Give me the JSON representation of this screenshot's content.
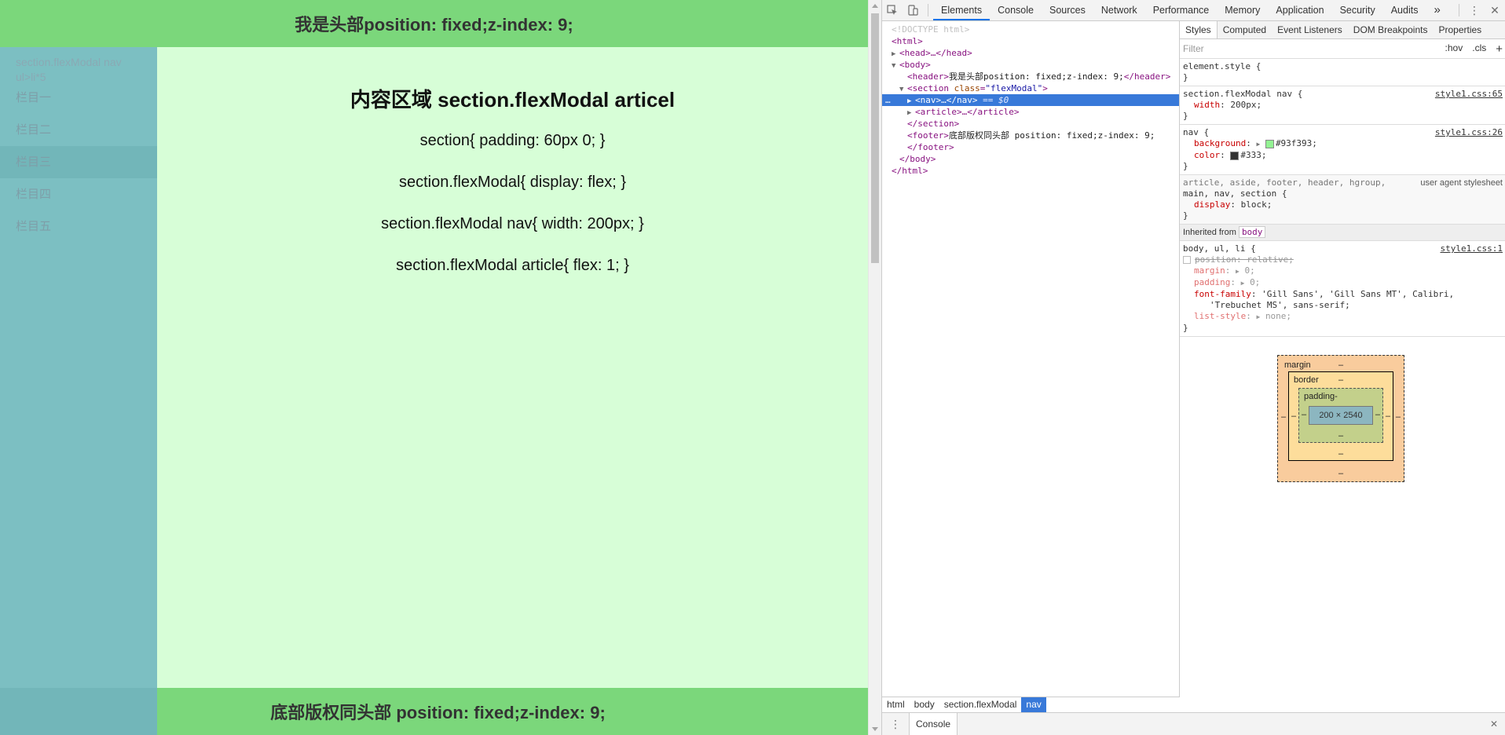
{
  "page": {
    "header_text": "我是头部position: fixed;z-index: 9;",
    "nav": {
      "title": "section.flexModal nav ul>li*5",
      "items": [
        "栏目一",
        "栏目二",
        "栏目三",
        "栏目四",
        "栏目五"
      ],
      "active_index": 2
    },
    "article": {
      "heading": "内容区域 section.flexModal articel",
      "lines": [
        "section{ padding: 60px 0; }",
        "section.flexModal{ display: flex; }",
        "section.flexModal nav{ width: 200px; }",
        "section.flexModal article{ flex: 1; }"
      ]
    },
    "footer_text": "底部版权同头部 position: fixed;z-index: 9;"
  },
  "devtools": {
    "tabs": [
      "Elements",
      "Console",
      "Sources",
      "Network",
      "Performance",
      "Memory",
      "Application",
      "Security",
      "Audits"
    ],
    "active_tab": "Elements",
    "more_tabs": "»",
    "elements_tree": {
      "doctype": "<!DOCTYPE html>",
      "html_open": "<html>",
      "head": "<head>…</head>",
      "body_open": "<body>",
      "header_open": "<header>",
      "header_text": "我是头部position: fixed;z-index: 9;",
      "header_close": "</header>",
      "section_tag": "<section",
      "section_attr": "class",
      "section_val": "\"flexModal\"",
      "section_end": ">",
      "nav": "<nav>…</nav>",
      "selected_marker": "== $0",
      "gutter_dots": "…",
      "article": "<article>…</article>",
      "section_close": "</section>",
      "footer_open": "<footer>",
      "footer_text": "底部版权同头部 position: fixed;z-index: 9;",
      "footer_close": "</footer>",
      "body_close": "</body>",
      "html_close": "</html>"
    },
    "breadcrumb": [
      "html",
      "body",
      "section.flexModal",
      "nav"
    ],
    "styles_tabs": [
      "Styles",
      "Computed",
      "Event Listeners",
      "DOM Breakpoints",
      "Properties"
    ],
    "filter_placeholder": "Filter",
    "filter_hov": ":hov",
    "filter_cls": ".cls",
    "filter_add": "+",
    "rules": {
      "element_style": "element.style {",
      "r1_selector": "section.flexModal nav {",
      "r1_source": "style1.css:65",
      "r1_prop": "width",
      "r1_value": "200px;",
      "r2_selector": "nav {",
      "r2_source": "style1.css:26",
      "r2_bg_prop": "background",
      "r2_bg_value": "#93f393;",
      "r2_bg_color": "#93f393",
      "r2_color_prop": "color",
      "r2_color_value": "#333;",
      "r2_color_color": "#333333",
      "ua_selector_1": "article, aside, footer, header, hgroup,",
      "ua_selector_2": "main, nav, section {",
      "ua_source": "user agent stylesheet",
      "ua_prop": "display",
      "ua_value": "block;",
      "inherited_label": "Inherited from",
      "inherited_from": "body",
      "r3_selector": "body, ul, li {",
      "r3_source": "style1.css:1",
      "r3_position": "position: relative;",
      "r3_margin_prop": "margin",
      "r3_margin_value": "0;",
      "r3_padding_prop": "padding",
      "r3_padding_value": "0;",
      "r3_font_prop": "font-family",
      "r3_font_value_1": "'Gill Sans', 'Gill Sans MT', Calibri,",
      "r3_font_value_2": "'Trebuchet MS', sans-serif;",
      "r3_list_prop": "list-style",
      "r3_list_value": "none;",
      "close_brace": "}"
    },
    "box_model": {
      "margin_label": "margin",
      "border_label": "border",
      "padding_label": "padding-",
      "content_size": "200 × 2540",
      "dash": "–"
    },
    "drawer_tab": "Console"
  }
}
